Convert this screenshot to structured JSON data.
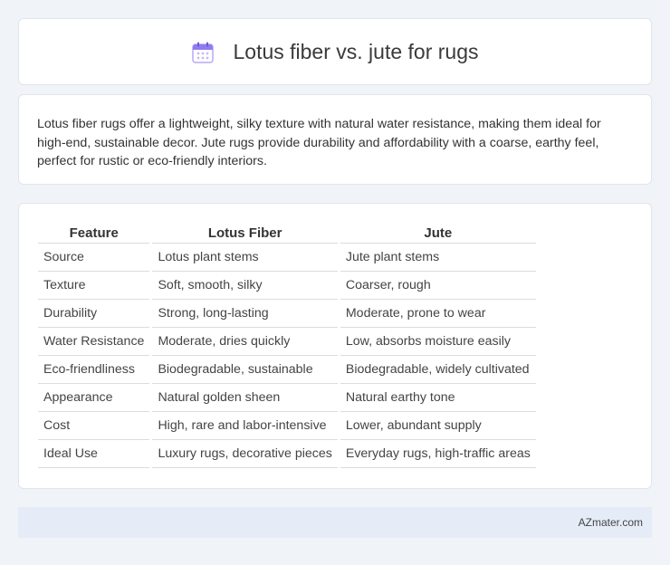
{
  "header": {
    "icon": "calendar-icon",
    "title": "Lotus fiber vs. jute for rugs"
  },
  "intro": {
    "text": "Lotus fiber rugs offer a lightweight, silky texture with natural water resistance, making them ideal for high-end, sustainable decor. Jute rugs provide durability and affordability with a coarse, earthy feel, perfect for rustic or eco-friendly interiors."
  },
  "table": {
    "headers": [
      "Feature",
      "Lotus Fiber",
      "Jute"
    ],
    "rows": [
      [
        "Source",
        "Lotus plant stems",
        "Jute plant stems"
      ],
      [
        "Texture",
        "Soft, smooth, silky",
        "Coarser, rough"
      ],
      [
        "Durability",
        "Strong, long-lasting",
        "Moderate, prone to wear"
      ],
      [
        "Water Resistance",
        "Moderate, dries quickly",
        "Low, absorbs moisture easily"
      ],
      [
        "Eco-friendliness",
        "Biodegradable, sustainable",
        "Biodegradable, widely cultivated"
      ],
      [
        "Appearance",
        "Natural golden sheen",
        "Natural earthy tone"
      ],
      [
        "Cost",
        "High, rare and labor-intensive",
        "Lower, abundant supply"
      ],
      [
        "Ideal Use",
        "Luxury rugs, decorative pieces",
        "Everyday rugs, high-traffic areas"
      ]
    ]
  },
  "footer": {
    "text": "AZmater.com"
  },
  "colors": {
    "background": "#f0f3f8",
    "card": "#ffffff",
    "footer_bar": "#e6ecf7",
    "icon_accent": "#8e7cf0"
  }
}
